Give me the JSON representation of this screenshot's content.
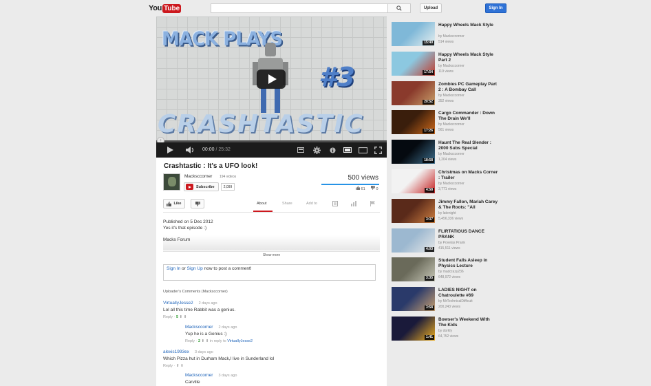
{
  "header": {
    "logo_you": "You",
    "logo_tube": "Tube",
    "search_placeholder": "",
    "upload_label": "Upload",
    "signin_label": "Sign In"
  },
  "player": {
    "overlay_title_top": "MACK PLAYS",
    "overlay_number": "#3",
    "overlay_title_bottom": "CRASHTASTIC",
    "time_current": "00:00",
    "time_separator": " / ",
    "time_duration": "25:32",
    "progress": 0
  },
  "video": {
    "title": "Crashtastic : It's a UFO look!",
    "channel_name": "Macksccorner",
    "channel_videos": "194 videos",
    "subscribe_label": "Subscribe",
    "subscriber_count": "2,099",
    "views": "500 views",
    "like_ratio": 1.0,
    "likes": "61",
    "dislikes": "0",
    "like_label": "Like"
  },
  "tabs": [
    {
      "label": "About"
    },
    {
      "label": "Share"
    },
    {
      "label": "Add to"
    }
  ],
  "description": {
    "published": "Published on 5 Dec 2012",
    "line1": "Yes it's that episode :)",
    "line2": "Macks Forum",
    "show_more": "Show more"
  },
  "comment_box": {
    "sign_in": "Sign In",
    "or": " or ",
    "sign_up": "Sign Up",
    "suffix": " now to post a comment!"
  },
  "comments": {
    "header": "Uploader's Comments (Macksccorner)",
    "items": [
      {
        "author": "VirtuallyJesse2",
        "time": "2 days ago",
        "text": "Lol all this time Rabbit was a genius.",
        "reply": "Reply",
        "score": "5",
        "in_reply_to": ""
      },
      {
        "author": "Macksccorner",
        "time": "2 days ago",
        "text": "Yup he is a Genius :)",
        "reply": "Reply",
        "score": "2",
        "in_reply_to_prefix": "in reply to ",
        "in_reply_to": "VirtuallyJesse2"
      },
      {
        "author": "alexis1993ex",
        "time": "3 days ago",
        "text": "Which Pizza hut in Durham Mack,I live in Sunderland lol",
        "reply": "Reply",
        "score": "",
        "in_reply_to": ""
      },
      {
        "author": "Macksccorner",
        "time": "3 days ago",
        "text": "Carville",
        "reply": "",
        "score": "",
        "in_reply_to": ""
      }
    ]
  },
  "related": [
    {
      "title": "Happy Wheels Mack Style",
      "by": "by Macksccorner",
      "views": "514 views",
      "duration": "15:40",
      "colors": [
        "#7fb8d8",
        "#e8f0f0"
      ]
    },
    {
      "title": "Happy Wheels Mack Style Part 2",
      "by": "by Macksccorner",
      "views": "119 views",
      "duration": "17:54",
      "colors": [
        "#8cc8e0",
        "#c0392b"
      ]
    },
    {
      "title": "Zombies PC Gameplay Part 2 : A Bombay Call",
      "by": "by Macksccorner",
      "views": "352 views",
      "duration": "20:52",
      "colors": [
        "#8a3a2c",
        "#c9a06a"
      ]
    },
    {
      "title": "Cargo Commander : Down The Drain We'll",
      "by": "by Macksccorner",
      "views": "561 views",
      "duration": "17:26",
      "colors": [
        "#3a1e0c",
        "#d06a1a"
      ]
    },
    {
      "title": "Haunt The Real Slender : 2000 Subs Special",
      "by": "by Macksccorner",
      "views": "1,204 views",
      "duration": "18:58",
      "colors": [
        "#050a10",
        "#3d6e8c"
      ]
    },
    {
      "title": "Christmas on Macks Corner : Trailer",
      "by": "by Macksccorner",
      "views": "3,771 views",
      "duration": "4:58",
      "colors": [
        "#f2f2f2",
        "#c62020"
      ]
    },
    {
      "title": "Jimmy Fallon, Mariah Carey & The Roots: \"All",
      "by": "by latenight",
      "views": "5,456,336 views",
      "duration": "3:37",
      "colors": [
        "#5a2a1a",
        "#d08040"
      ]
    },
    {
      "title": "FLIRTATIOUS DANCE PRANK",
      "by": "by Povelas Prank",
      "views": "415,511 views",
      "duration": "4:03",
      "colors": [
        "#9cb8d0",
        "#e8e8e8"
      ]
    },
    {
      "title": "Student Falls Asleep in Physics Lecture",
      "by": "by madcrazy236",
      "views": "648,972 views",
      "duration": "3:35",
      "colors": [
        "#6a6a5a",
        "#c8c8b8"
      ]
    },
    {
      "title": "LADIES NIGHT on Chatroulette #69",
      "by": "by MrTechnicalDifficult",
      "views": "200,243 views",
      "duration": "3:58",
      "colors": [
        "#2a3a6a",
        "#c8a070"
      ]
    },
    {
      "title": "Bowser's Weekend With The Kids",
      "by": "by dorkly",
      "views": "64,752 views",
      "duration": "1:41",
      "colors": [
        "#1a1a3a",
        "#f0b020"
      ]
    }
  ]
}
